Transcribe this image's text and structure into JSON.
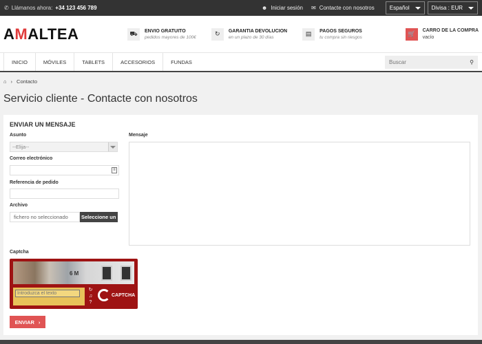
{
  "topbar": {
    "phone_label": "Llámanos ahora:",
    "phone_number": "+34 123 456 789",
    "login": "Iniciar sesión",
    "contact": "Contacte con nosotros",
    "language": "Español",
    "currency": "Divisa : EUR"
  },
  "header": {
    "logo_prefix": "A",
    "logo_m": "M",
    "logo_suffix": "ALTEA",
    "features": [
      {
        "title": "ENVIO GRATUITO",
        "subtitle": "pedidos mayores de 100€"
      },
      {
        "title": "GARANTIA DEVOLUCION",
        "subtitle": "en un plazo de 30 días"
      },
      {
        "title": "PAGOS SEGUROS",
        "subtitle": "tu compra sin riesgos"
      }
    ],
    "cart_title": "CARRO DE LA COMPRA",
    "cart_status": "vacío"
  },
  "nav": {
    "items": [
      "INICIO",
      "MÓVILES",
      "TABLETS",
      "ACCESORIOS",
      "FUNDAS"
    ],
    "search_placeholder": "Buscar"
  },
  "breadcrumb": {
    "current": "Contacto"
  },
  "page_title": "Servicio cliente - Contacte con nosotros",
  "form": {
    "heading": "ENVIAR UN MENSAJE",
    "subject_label": "Asunto",
    "subject_value": "--Elija--",
    "email_label": "Correo electrónico",
    "order_label": "Referencia de pedido",
    "file_label": "Archivo",
    "file_none": "fichero no seleccionado",
    "file_button": "Seleccione un",
    "message_label": "Mensaje",
    "captcha_label": "Captcha",
    "captcha_word": "6 M",
    "captcha_placeholder": "Introduzca el texto",
    "captcha_brand": "CAPTCHA",
    "send_label": "ENVIAR"
  },
  "colors": {
    "accent": "#e05454",
    "dark": "#333333",
    "captcha_red": "#9e1313"
  }
}
